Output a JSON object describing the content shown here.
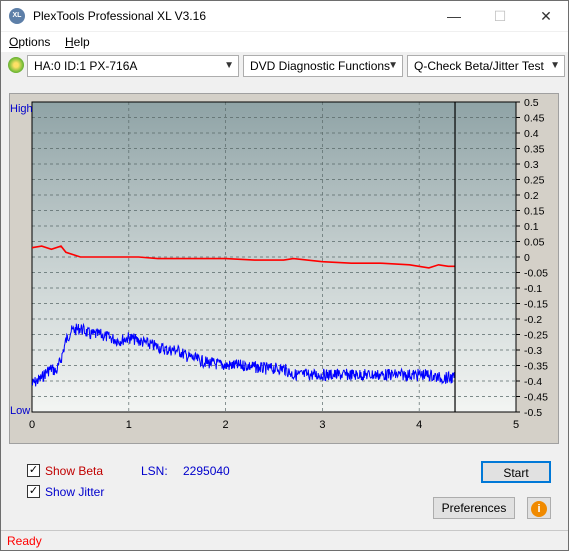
{
  "window": {
    "title": "PlexTools Professional XL V3.16",
    "icon_label": "XL"
  },
  "menu": {
    "items": [
      "Options",
      "Help"
    ]
  },
  "toolbar": {
    "drive": "HA:0 ID:1  PX-716A",
    "function": "DVD Diagnostic Functions",
    "test": "Q-Check Beta/Jitter Test"
  },
  "chart_data": {
    "type": "line",
    "y_left_top_label": "High",
    "y_left_bottom_label": "Low",
    "xlim": [
      0,
      5
    ],
    "ylim": [
      -0.5,
      0.5
    ],
    "x_ticks": [
      "0",
      "1",
      "2",
      "3",
      "4",
      "5"
    ],
    "y_ticks": [
      "0.5",
      "0.45",
      "0.4",
      "0.35",
      "0.3",
      "0.25",
      "0.2",
      "0.15",
      "0.1",
      "0.05",
      "0",
      "-0.05",
      "-0.1",
      "-0.15",
      "-0.2",
      "-0.25",
      "-0.3",
      "-0.35",
      "-0.4",
      "-0.45",
      "-0.5"
    ],
    "end_marker_x": 4.37,
    "series": [
      {
        "name": "Beta",
        "color": "#ff0000",
        "x": [
          0,
          0.1,
          0.2,
          0.3,
          0.35,
          0.5,
          0.7,
          0.9,
          1.1,
          1.3,
          1.5,
          1.8,
          2.0,
          2.3,
          2.6,
          2.7,
          3.0,
          3.3,
          3.6,
          3.9,
          4.1,
          4.2,
          4.3,
          4.37
        ],
        "y": [
          0.03,
          0.035,
          0.025,
          0.035,
          0.015,
          0.0,
          0.0,
          0.0,
          0.0,
          -0.005,
          -0.005,
          -0.005,
          -0.005,
          -0.01,
          -0.01,
          -0.005,
          -0.015,
          -0.02,
          -0.02,
          -0.025,
          -0.035,
          -0.025,
          -0.03,
          -0.03
        ]
      },
      {
        "name": "Jitter",
        "color": "#0000ff",
        "x": [
          0,
          0.1,
          0.15,
          0.2,
          0.25,
          0.3,
          0.35,
          0.4,
          0.5,
          0.6,
          0.7,
          0.8,
          0.9,
          1.0,
          1.1,
          1.2,
          1.3,
          1.4,
          1.5,
          1.6,
          1.7,
          1.8,
          2.0,
          2.2,
          2.4,
          2.6,
          2.7,
          2.9,
          3.1,
          3.3,
          3.5,
          3.7,
          3.9,
          4.1,
          4.2,
          4.3,
          4.37
        ],
        "y": [
          -0.41,
          -0.39,
          -0.37,
          -0.36,
          -0.37,
          -0.33,
          -0.27,
          -0.24,
          -0.23,
          -0.25,
          -0.25,
          -0.26,
          -0.27,
          -0.26,
          -0.27,
          -0.28,
          -0.29,
          -0.3,
          -0.3,
          -0.32,
          -0.33,
          -0.34,
          -0.35,
          -0.35,
          -0.36,
          -0.36,
          -0.38,
          -0.38,
          -0.38,
          -0.38,
          -0.38,
          -0.38,
          -0.38,
          -0.38,
          -0.39,
          -0.39,
          -0.39
        ]
      }
    ]
  },
  "controls": {
    "show_beta_label": "Show Beta",
    "show_beta_checked": true,
    "show_jitter_label": "Show Jitter",
    "show_jitter_checked": true,
    "lsn_label": "LSN:",
    "lsn_value": "2295040",
    "start_label": "Start",
    "preferences_label": "Preferences",
    "info_icon": "info-icon"
  },
  "status": {
    "text": "Ready",
    "color": "#ff0000"
  }
}
